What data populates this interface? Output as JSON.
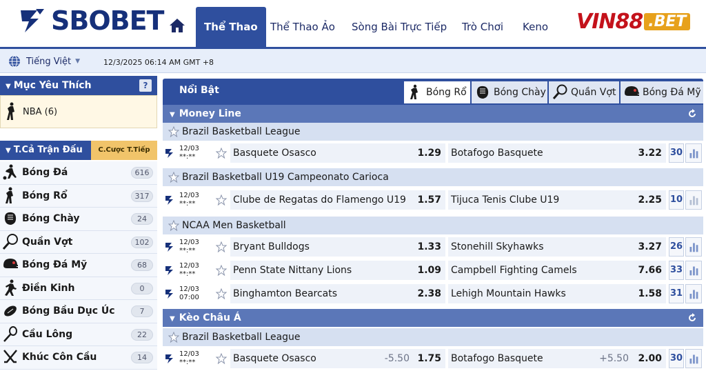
{
  "header": {
    "logo_text": "SBOBET",
    "nav": [
      {
        "label": "Thể Thao",
        "active": true
      },
      {
        "label": "Thể Thao Ảo",
        "active": false
      },
      {
        "label": "Sòng Bài Trực Tiếp",
        "active": false
      },
      {
        "label": "Trò Chơi",
        "active": false
      },
      {
        "label": "Keno",
        "active": false
      }
    ],
    "promo_part1": "VIN88",
    "promo_part2": ".BET"
  },
  "subbar": {
    "language": "Tiếng Việt",
    "datetime": "12/3/2025 06:14 AM GMT +8"
  },
  "sidebar": {
    "favorites_title": "Mục Yêu Thích",
    "favorites_help": "?",
    "favorite_item": "NBA (6)",
    "tab_all": "T.Cả Trận Đấu",
    "tab_live": "C.Cược T.Tiếp",
    "sports": [
      {
        "name": "Bóng Đá",
        "count": "616",
        "icon": "soccer-player-icon"
      },
      {
        "name": "Bóng Rổ",
        "count": "317",
        "icon": "basketball-player-icon"
      },
      {
        "name": "Bóng Chày",
        "count": "24",
        "icon": "baseball-glove-icon"
      },
      {
        "name": "Quần Vợt",
        "count": "102",
        "icon": "tennis-racket-icon"
      },
      {
        "name": "Bóng Đá Mỹ",
        "count": "68",
        "icon": "football-helmet-icon"
      },
      {
        "name": "Điền Kinh",
        "count": "0",
        "icon": "runner-icon"
      },
      {
        "name": "Bóng Bầu Dục Úc",
        "count": "7",
        "icon": "rugby-ball-icon"
      },
      {
        "name": "Cầu Lông",
        "count": "22",
        "icon": "badminton-racket-icon"
      },
      {
        "name": "Khúc Côn Cầu",
        "count": "14",
        "icon": "hockey-sticks-icon"
      }
    ]
  },
  "main": {
    "featured_title": "Nổi Bật",
    "sport_tabs": [
      {
        "label": "Bóng Rổ",
        "active": true,
        "icon": "basketball-player-icon"
      },
      {
        "label": "Bóng Chày",
        "active": false,
        "icon": "baseball-glove-icon"
      },
      {
        "label": "Quần Vợt",
        "active": false,
        "icon": "tennis-racket-icon"
      },
      {
        "label": "Bóng Đá Mỹ",
        "active": false,
        "icon": "football-helmet-icon"
      }
    ],
    "sections": [
      {
        "title": "Money Line",
        "leagues": [
          {
            "name": "Brazil Basketball League",
            "matches": [
              {
                "date": "12/03",
                "time": "**:**",
                "home": "Basquete Osasco",
                "home_odd": "1.29",
                "away": "Botafogo Basquete",
                "away_odd": "3.22",
                "more": "30"
              }
            ]
          },
          {
            "name": "Brazil Basketball U19 Campeonato Carioca",
            "matches": [
              {
                "date": "12/03",
                "time": "**:**",
                "home": "Clube de Regatas do Flamengo U19",
                "home_odd": "1.57",
                "away": "Tijuca Tenis Clube U19",
                "away_odd": "2.25",
                "more": "10"
              }
            ]
          },
          {
            "name": "NCAA Men Basketball",
            "matches": [
              {
                "date": "12/03",
                "time": "**:**",
                "home": "Bryant Bulldogs",
                "home_odd": "1.33",
                "away": "Stonehill Skyhawks",
                "away_odd": "3.27",
                "more": "26"
              },
              {
                "date": "12/03",
                "time": "**:**",
                "home": "Penn State Nittany Lions",
                "home_odd": "1.09",
                "away": "Campbell Fighting Camels",
                "away_odd": "7.66",
                "more": "33"
              },
              {
                "date": "12/03",
                "time": "07:00",
                "home": "Binghamton Bearcats",
                "home_odd": "2.38",
                "away": "Lehigh Mountain Hawks",
                "away_odd": "1.58",
                "more": "31"
              }
            ]
          }
        ]
      },
      {
        "title": "Kèo Châu Á",
        "leagues": [
          {
            "name": "Brazil Basketball League",
            "matches": [
              {
                "date": "12/03",
                "time": "**:**",
                "home": "Basquete Osasco",
                "home_hdp": "-5.50",
                "home_odd": "1.75",
                "away": "Botafogo Basquete",
                "away_hdp": "+5.50",
                "away_odd": "2.00",
                "more": "30"
              }
            ]
          }
        ]
      }
    ]
  },
  "colors": {
    "brand_navy": "#16307a",
    "header_blue": "#2f4f9e",
    "section_blue": "#5b77b8",
    "league_bg": "#d6e0f1",
    "live_tab_gold": "#f1c46a",
    "promo_red": "#c4121b"
  }
}
